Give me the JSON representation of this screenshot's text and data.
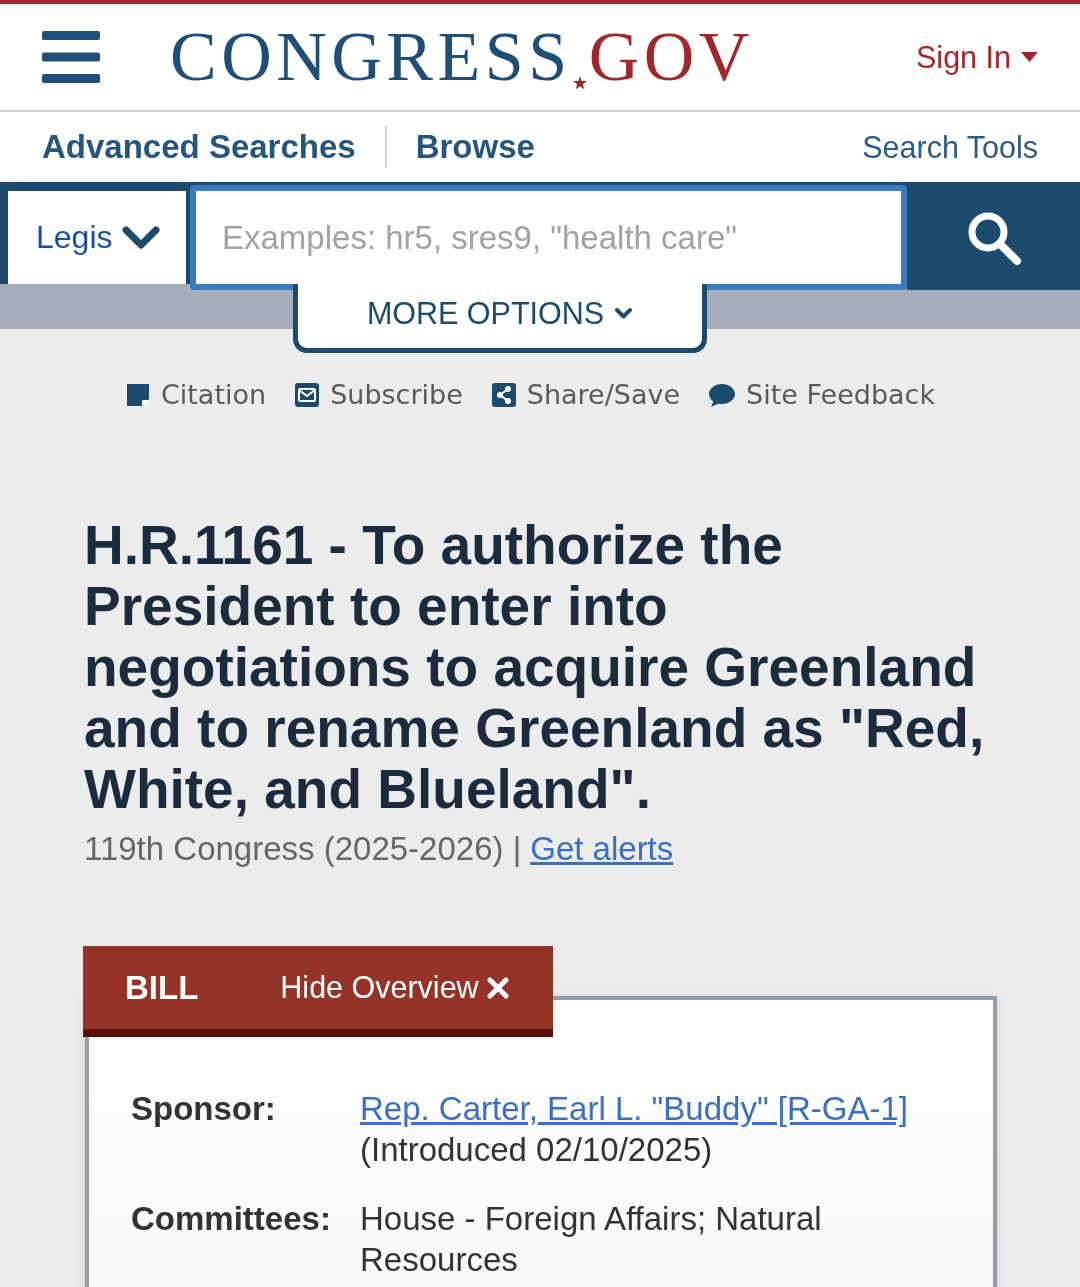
{
  "header": {
    "logo": {
      "main": "CONGRESS",
      "domain": "GOV"
    },
    "sign_in": "Sign In"
  },
  "nav": {
    "items": [
      {
        "label": "Advanced Searches"
      },
      {
        "label": "Browse"
      }
    ],
    "search_tools": "Search Tools"
  },
  "search": {
    "collection": "Legis",
    "placeholder": "Examples: hr5, sres9, \"health care\"",
    "more_options": "MORE OPTIONS"
  },
  "actions": [
    {
      "kind": "citation",
      "label": "Citation"
    },
    {
      "kind": "subscribe",
      "label": "Subscribe"
    },
    {
      "kind": "share",
      "label": "Share/Save"
    },
    {
      "kind": "feedback",
      "label": "Site Feedback"
    }
  ],
  "bill": {
    "title": "H.R.1161 - To authorize the President to enter into negotiations to acquire Greenland and to rename Greenland as \"Red, White, and Blueland\".",
    "congress": "119th Congress (2025-2026) |",
    "alerts_link": "Get alerts"
  },
  "overview": {
    "tab": "BILL",
    "toggle": "Hide Overview",
    "rows": [
      {
        "kind": "sponsor",
        "label": "Sponsor:",
        "link": "Rep. Carter, Earl L. \"Buddy\" [R-GA-1]",
        "note": "(Introduced 02/10/2025)"
      },
      {
        "kind": "text",
        "label": "Committees:",
        "value": "House - Foreign Affairs; Natural Resources"
      }
    ]
  }
}
